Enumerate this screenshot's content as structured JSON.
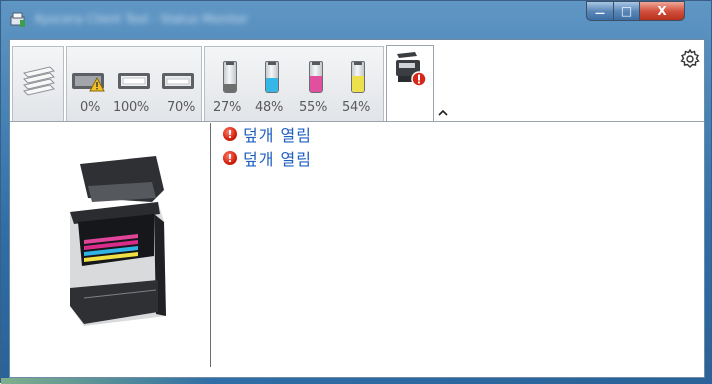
{
  "window": {
    "title": "Kyocera Client Tool - Status Monitor",
    "minimize_label": "—",
    "maximize_label": "□",
    "close_label": "X",
    "colors": {
      "frame": "#2f6ea6",
      "close": "#c63a25",
      "link": "#1f5fbf"
    }
  },
  "tabs": [
    {
      "name": "paper-stack",
      "icon": "paper-stack-icon"
    },
    {
      "name": "paper-trays",
      "icon": "paper-tray-icon",
      "trays": [
        {
          "level": "0%",
          "warning": true
        },
        {
          "level": "100%",
          "warning": false
        },
        {
          "level": "70%",
          "warning": false
        }
      ]
    },
    {
      "name": "toner",
      "icon": "toner-cartridge-icon",
      "toners": [
        {
          "color": "black",
          "hex": "#6e6e6e",
          "level": "27%",
          "fraction": 0.27
        },
        {
          "color": "cyan",
          "hex": "#35b8e8",
          "level": "48%",
          "fraction": 0.48
        },
        {
          "color": "magenta",
          "hex": "#e0509f",
          "level": "55%",
          "fraction": 0.55
        },
        {
          "color": "yellow",
          "hex": "#ede04d",
          "level": "54%",
          "fraction": 0.54
        }
      ]
    },
    {
      "name": "device-status",
      "icon": "printer-error-icon",
      "active": true
    }
  ],
  "collapse_icon": "chevron-up-icon",
  "settings_icon": "gear-icon",
  "messages": [
    {
      "icon": "error-icon",
      "text": "덮개 열림"
    },
    {
      "icon": "error-icon",
      "text": "덮개 열림"
    }
  ],
  "printer_image": "printer-open-cover-icon"
}
